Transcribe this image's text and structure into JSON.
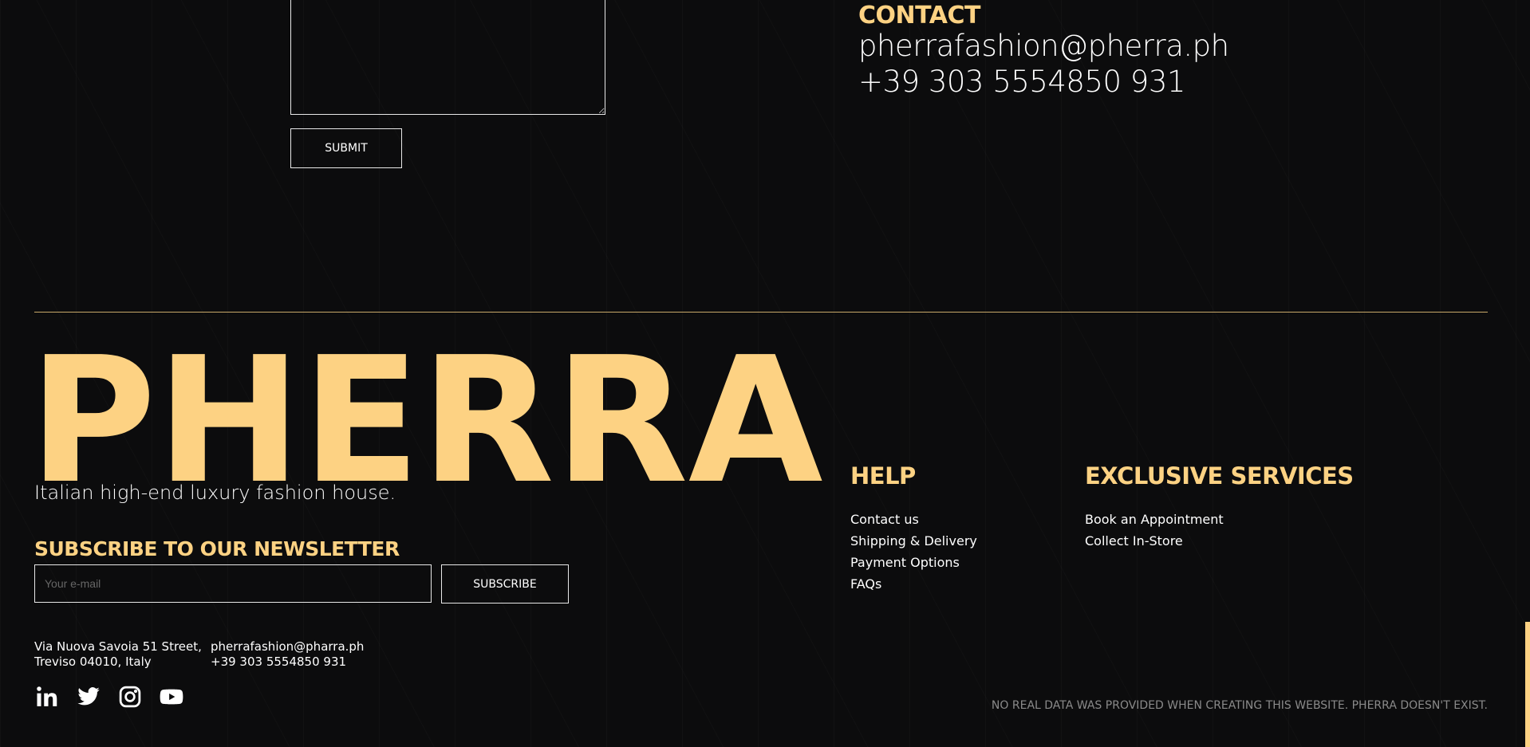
{
  "form": {
    "submit_label": "SUBMIT"
  },
  "contact": {
    "heading": "CONTACT",
    "email": "pherrafashion@pherra.ph",
    "phone": "+39 303 5554850 931"
  },
  "brand": {
    "name": "PHERRA",
    "tagline": "Italian high-end luxury fashion house."
  },
  "newsletter": {
    "heading": "SUBSCRIBE TO OUR NEWSLETTER",
    "placeholder": "Your e-mail",
    "button_label": "SUBSCRIBE"
  },
  "footer": {
    "address_line1": "Via Nuova Savoia 51 Street,",
    "address_line2": "Treviso 04010, Italy",
    "email": "pherrafashion@pharra.ph",
    "phone": "+39 303 5554850 931",
    "socials": [
      "linkedin-icon",
      "twitter-icon",
      "instagram-icon",
      "youtube-icon"
    ],
    "disclaimer": "NO REAL DATA WAS PROVIDED WHEN CREATING THIS WEBSITE. PHERRA DOESN'T EXIST."
  },
  "help": {
    "heading": "HELP",
    "items": [
      "Contact us",
      "Shipping & Delivery",
      "Payment Options",
      "FAQs"
    ]
  },
  "services": {
    "heading": "EXCLUSIVE SERVICES",
    "items": [
      "Book an Appointment",
      "Collect In-Store"
    ]
  },
  "colors": {
    "accent": "#fdd283",
    "background": "#0c0c0d",
    "divider": "#c9a96a",
    "muted": "#8a8a8a"
  }
}
